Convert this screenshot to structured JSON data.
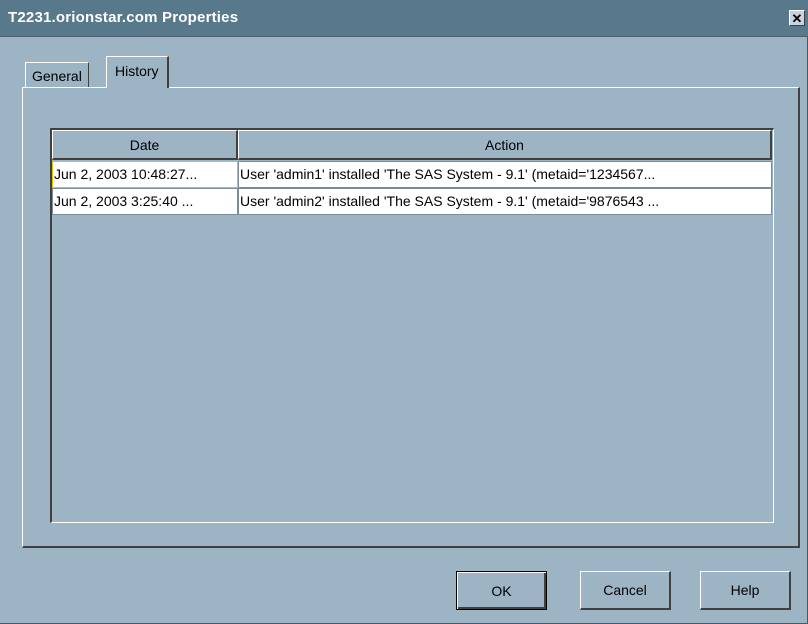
{
  "window": {
    "title": "T2231.orionstar.com Properties",
    "close_glyph": "✕"
  },
  "tabs": [
    {
      "label": "General",
      "selected": false
    },
    {
      "label": "History",
      "selected": true
    }
  ],
  "history_table": {
    "columns": [
      "Date",
      "Action"
    ],
    "rows": [
      {
        "date": "Jun 2, 2003 10:48:27...",
        "action": "User 'admin1' installed 'The SAS System - 9.1' (metaid='1234567..."
      },
      {
        "date": "Jun 2, 2003 3:25:40 ...",
        "action": "User 'admin2' installed 'The SAS System - 9.1' (metaid='9876543 ..."
      }
    ]
  },
  "buttons": {
    "ok": "OK",
    "cancel": "Cancel",
    "help": "Help"
  },
  "colors": {
    "background": "#9db4c4",
    "titlebar": "#58788c",
    "title_text": "#ffffff",
    "focus_border": "#d8c800"
  }
}
